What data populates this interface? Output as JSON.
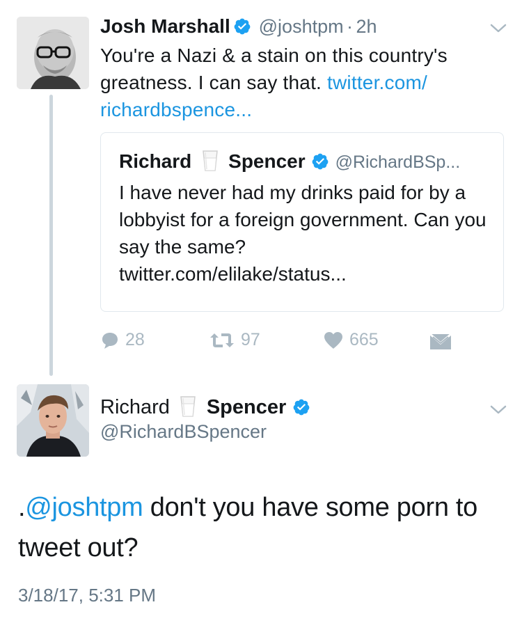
{
  "tweet1": {
    "author_name": "Josh Marshall",
    "handle": "@joshtpm",
    "separator": "·",
    "time": "2h",
    "text": "You're a Nazi & a stain on this country's greatness. I can say that.",
    "link_line1": "twitter.com/",
    "link_line2": "richardbspence...",
    "quote": {
      "name_first": "Richard",
      "name_last": "Spencer",
      "handle": "@RichardBSp...",
      "text": "I have never had my drinks paid for by a lobbyist for a foreign government. Can you say the same?",
      "link": "twitter.com/elilake/status..."
    },
    "actions": {
      "replies": "28",
      "retweets": "97",
      "likes": "665"
    }
  },
  "tweet2": {
    "name_first": "Richard",
    "name_last": "Spencer",
    "handle": "@RichardBSpencer",
    "mention_prefix": ".",
    "mention": "@joshtpm",
    "text": " don't you have some porn to tweet out?",
    "timestamp": "3/18/17, 5:31 PM"
  },
  "colors": {
    "link": "#1b95e0",
    "verified": "#1da1f2",
    "muted": "#657786",
    "action": "#aab8c2",
    "border": "#e1e8ed"
  },
  "icons": {
    "verified": "verified-badge-icon",
    "milk": "milk-glass-icon",
    "chevron": "chevron-down-icon",
    "reply": "reply-icon",
    "retweet": "retweet-icon",
    "like": "heart-icon",
    "dm": "envelope-icon"
  }
}
